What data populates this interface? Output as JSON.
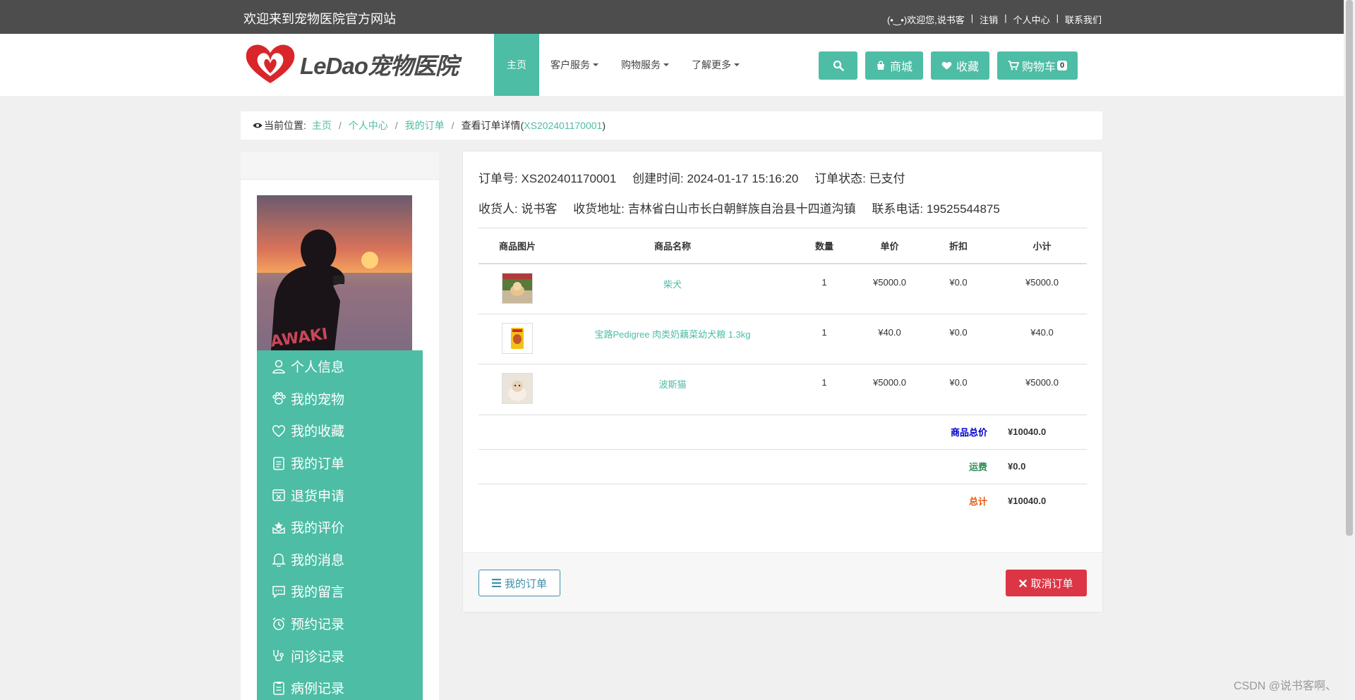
{
  "topbar": {
    "welcome": "欢迎来到宠物医院官方网站",
    "user_greeting": "(•‿•)欢迎您,说书客",
    "logout": "注销",
    "personal_center": "个人中心",
    "contact": "联系我们",
    "separator": "|"
  },
  "header": {
    "logo_text": "LeDao宠物医院",
    "nav": [
      "主页",
      "客户服务",
      "购物服务",
      "了解更多"
    ],
    "buttons": {
      "mall": "商城",
      "favorites": "收藏",
      "cart": "购物车",
      "cart_count": "0"
    }
  },
  "breadcrumb": {
    "prefix": "当前位置:",
    "home": "主页",
    "center": "个人中心",
    "orders": "我的订单",
    "current_prefix": "查看订单详情(",
    "order_no": "XS202401170001",
    "current_suffix": ")"
  },
  "sidebar": {
    "menu": [
      {
        "label": "个人信息",
        "icon": "user-icon"
      },
      {
        "label": "我的宠物",
        "icon": "paw-icon"
      },
      {
        "label": "我的收藏",
        "icon": "heart-icon"
      },
      {
        "label": "我的订单",
        "icon": "clipboard-icon"
      },
      {
        "label": "退货申请",
        "icon": "return-box-icon"
      },
      {
        "label": "我的评价",
        "icon": "review-icon"
      },
      {
        "label": "我的消息",
        "icon": "bell-icon"
      },
      {
        "label": "我的留言",
        "icon": "chat-icon"
      },
      {
        "label": "预约记录",
        "icon": "alarm-icon"
      },
      {
        "label": "问诊记录",
        "icon": "stethoscope-icon"
      },
      {
        "label": "病例记录",
        "icon": "record-icon"
      }
    ]
  },
  "order": {
    "order_no_label": "订单号: XS202401170001",
    "created_label": "创建时间: 2024-01-17 15:16:20",
    "status_label": "订单状态: 已支付",
    "receiver_label": "收货人: 说书客",
    "address_label": "收货地址: 吉林省白山市长白朝鲜族自治县十四道沟镇",
    "phone_label": "联系电话: 19525544875",
    "columns": [
      "商品图片",
      "商品名称",
      "数量",
      "单价",
      "折扣",
      "小计"
    ],
    "items": [
      {
        "name": "柴犬",
        "qty": "1",
        "price": "¥5000.0",
        "discount": "¥0.0",
        "subtotal": "¥5000.0"
      },
      {
        "name": "宝路Pedigree 肉类奶藕菜幼犬粮 1.3kg",
        "qty": "1",
        "price": "¥40.0",
        "discount": "¥0.0",
        "subtotal": "¥40.0"
      },
      {
        "name": "波斯猫",
        "qty": "1",
        "price": "¥5000.0",
        "discount": "¥0.0",
        "subtotal": "¥5000.0"
      }
    ],
    "totals": {
      "goods_label": "商品总价",
      "goods_value": "¥10040.0",
      "shipping_label": "运费",
      "shipping_value": "¥0.0",
      "total_label": "总计",
      "total_value": "¥10040.0"
    },
    "btn_orders": "我的订单",
    "btn_cancel": "取消订单"
  },
  "colors": {
    "accent": "#4dbda5",
    "danger": "#dc3545",
    "goods_total": "#0000cc",
    "shipping": "#2e8b57",
    "grand_total": "#e8590c"
  },
  "watermark": "CSDN @说书客啊、"
}
